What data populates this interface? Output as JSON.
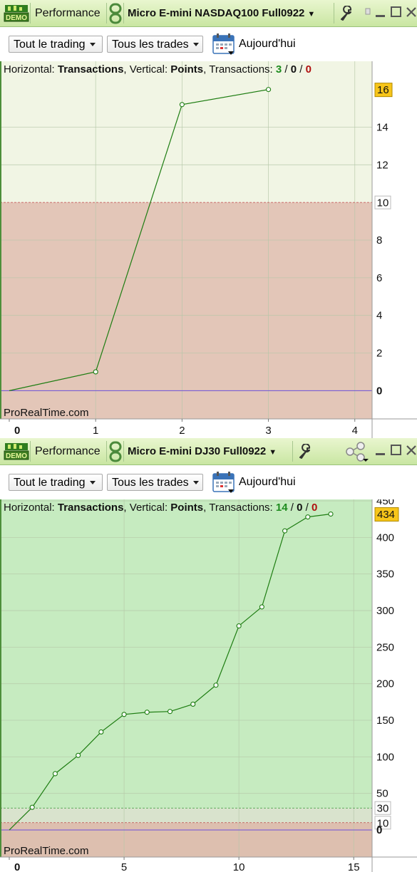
{
  "panels": [
    {
      "title_label": "Performance",
      "instrument": "Micro E-mini NASDAQ100 Full0922",
      "demo_badge": "DEMO",
      "filters": {
        "trading": "Tout le trading",
        "trades": "Tous les trades",
        "date": "Aujourd'hui"
      },
      "header": {
        "h_label": "Horizontal:",
        "h_value": "Transactions",
        "v_label": "Vertical:",
        "v_value": "Points",
        "t_label": "Transactions:",
        "count_total": "3",
        "count_a": "0",
        "count_b": "0",
        "slash": "/"
      },
      "watermark": "ProRealTime.com"
    },
    {
      "title_label": "Performance",
      "instrument": "Micro E-mini DJ30 Full0922",
      "demo_badge": "DEMO",
      "filters": {
        "trading": "Tout le trading",
        "trades": "Tous les trades",
        "date": "Aujourd'hui"
      },
      "header": {
        "h_label": "Horizontal:",
        "h_value": "Transactions",
        "v_label": "Vertical:",
        "v_value": "Points",
        "t_label": "Transactions:",
        "count_total": "14",
        "count_a": "0",
        "count_b": "0",
        "slash": "/"
      },
      "watermark": "ProRealTime.com"
    }
  ],
  "chart_data": [
    {
      "type": "line",
      "x": [
        0,
        1,
        2,
        3
      ],
      "y": [
        0,
        1,
        15.2,
        16
      ],
      "xlim": [
        0,
        4.2
      ],
      "ylim": [
        -1.5,
        17.5
      ],
      "xticks": [
        0,
        1,
        2,
        3,
        4
      ],
      "yticks": [
        2,
        4,
        6,
        8,
        12,
        14
      ],
      "y_zero_label": "0",
      "last_value_label": "16",
      "reference_lines": [
        {
          "value": 10,
          "label": "10",
          "color": "#c04a4a"
        }
      ],
      "bands": [
        {
          "from": 10,
          "to": 17.5,
          "color": "#f1f5e4"
        },
        {
          "from": -1.5,
          "to": 10,
          "color": "#e3c6b8"
        }
      ],
      "zero_line_color": "#6b4fd8",
      "line_color": "#1e7d12"
    },
    {
      "type": "line",
      "x": [
        0,
        1,
        2,
        3,
        4,
        5,
        6,
        7,
        8,
        9,
        10,
        11,
        12,
        13,
        14
      ],
      "y": [
        0,
        31,
        77,
        102,
        134,
        158,
        161,
        162,
        172,
        198,
        279,
        305,
        409,
        428,
        432
      ],
      "xlim": [
        0,
        15.8
      ],
      "ylim": [
        -37,
        452
      ],
      "xticks": [
        0,
        5,
        10,
        15
      ],
      "yticks": [
        50,
        100,
        150,
        200,
        250,
        300,
        350,
        400,
        450
      ],
      "y_zero_label": "0",
      "last_value_label": "434",
      "reference_lines": [
        {
          "value": 30,
          "label": "30",
          "color": "#3a9c3a"
        },
        {
          "value": 10,
          "label": "10",
          "color": "#c04a4a"
        }
      ],
      "bands": [
        {
          "from": 30,
          "to": 452,
          "color": "#c6ebc0"
        },
        {
          "from": 10,
          "to": 30,
          "color": "#d9e3cd"
        },
        {
          "from": -37,
          "to": 10,
          "color": "#ddbfaf"
        }
      ],
      "zero_line_color": "#6b4fd8",
      "line_color": "#1e7d12"
    }
  ]
}
